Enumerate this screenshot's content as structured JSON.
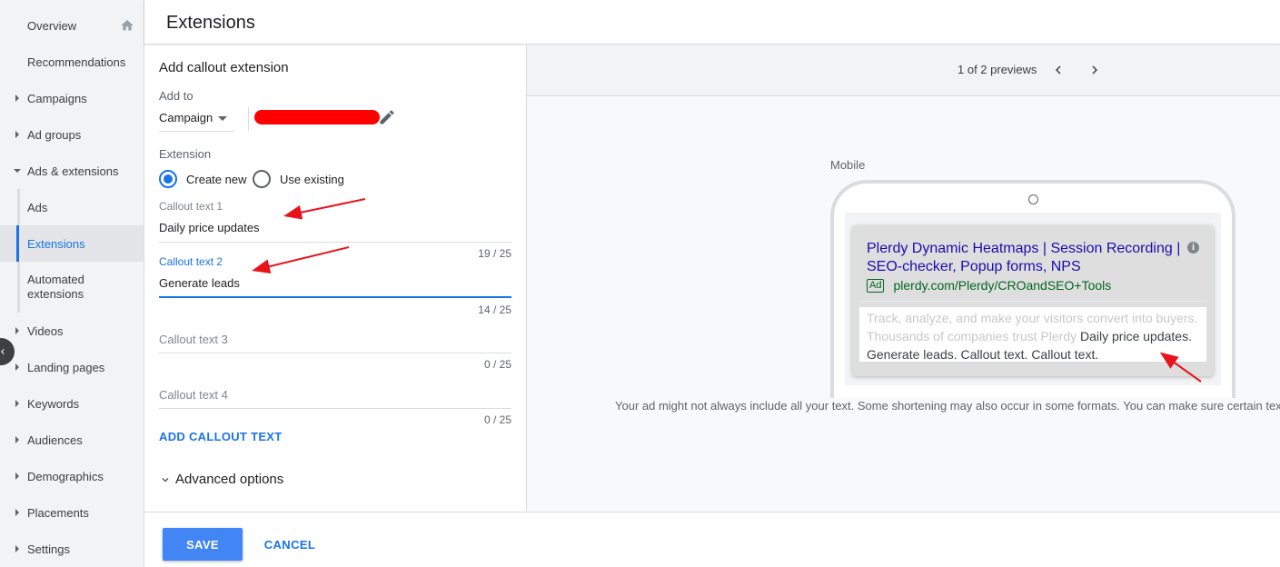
{
  "sidebar": {
    "items": [
      {
        "label": "Overview"
      },
      {
        "label": "Recommendations"
      },
      {
        "label": "Campaigns"
      },
      {
        "label": "Ad groups"
      },
      {
        "label": "Ads & extensions"
      },
      {
        "label": "Ads"
      },
      {
        "label": "Extensions"
      },
      {
        "label": "Automated extensions"
      },
      {
        "label": "Videos"
      },
      {
        "label": "Landing pages"
      },
      {
        "label": "Keywords"
      },
      {
        "label": "Audiences"
      },
      {
        "label": "Demographics"
      },
      {
        "label": "Placements"
      },
      {
        "label": "Settings"
      }
    ],
    "active": "Extensions"
  },
  "header": {
    "title": "Extensions"
  },
  "form": {
    "heading": "Add callout extension",
    "add_to_label": "Add to",
    "level_value": "Campaign",
    "extension_label": "Extension",
    "radio_create": "Create new",
    "radio_existing": "Use existing",
    "fields": [
      {
        "label": "Callout text 1",
        "value": "Daily price updates",
        "count": "19 / 25"
      },
      {
        "label": "Callout text 2",
        "value": "Generate leads",
        "count": "14 / 25"
      },
      {
        "label": "Callout text 3",
        "value": "",
        "count": "0 / 25"
      },
      {
        "label": "Callout text 4",
        "value": "",
        "count": "0 / 25"
      }
    ],
    "add_callout": "ADD CALLOUT TEXT",
    "advanced": "Advanced options"
  },
  "footer": {
    "save": "SAVE",
    "cancel": "CANCEL"
  },
  "preview": {
    "counter": "1 of 2 previews",
    "device_label": "Mobile",
    "ad": {
      "title": "Plerdy Dynamic Heatmaps | Session Recording | SEO-checker, Popup forms, NPS",
      "badge": "Ad",
      "url": "plerdy.com/Plerdy/CROandSEO+Tools",
      "desc_faded_1": "Track, analyze, and make your visitors convert into buyers.",
      "desc_faded_2": "Thousands of companies trust Plerdy",
      "desc_dark_1": "Daily price updates.",
      "desc_dark_2": "Generate leads. Callout text. Callout text."
    },
    "note": "Your ad might not always include all your text. Some shortening may also occur in some formats. You can make sure certain tex"
  },
  "colors": {
    "accent": "#1a73e8",
    "save_button": "#4285f4",
    "annotation": "#e8141c",
    "redaction": "#ff0000"
  }
}
